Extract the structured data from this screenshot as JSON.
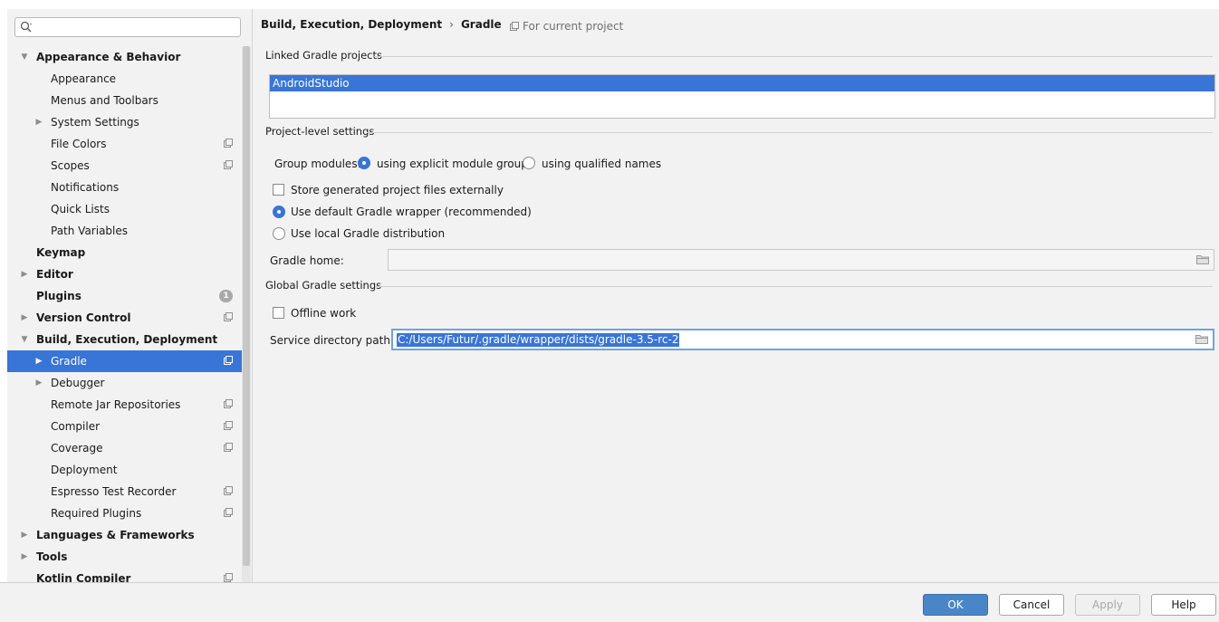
{
  "search": {
    "placeholder": ""
  },
  "sidebar": {
    "items": [
      {
        "label": "Appearance & Behavior",
        "bold": true,
        "level": 0,
        "arrow": "expanded",
        "proj": false
      },
      {
        "label": "Appearance",
        "bold": false,
        "level": 1,
        "arrow": "",
        "proj": false
      },
      {
        "label": "Menus and Toolbars",
        "bold": false,
        "level": 1,
        "arrow": "",
        "proj": false
      },
      {
        "label": "System Settings",
        "bold": false,
        "level": 1,
        "arrow": "collapsed",
        "proj": false
      },
      {
        "label": "File Colors",
        "bold": false,
        "level": 1,
        "arrow": "",
        "proj": true
      },
      {
        "label": "Scopes",
        "bold": false,
        "level": 1,
        "arrow": "",
        "proj": true
      },
      {
        "label": "Notifications",
        "bold": false,
        "level": 1,
        "arrow": "",
        "proj": false
      },
      {
        "label": "Quick Lists",
        "bold": false,
        "level": 1,
        "arrow": "",
        "proj": false
      },
      {
        "label": "Path Variables",
        "bold": false,
        "level": 1,
        "arrow": "",
        "proj": false
      },
      {
        "label": "Keymap",
        "bold": true,
        "level": 0,
        "arrow": "",
        "proj": false
      },
      {
        "label": "Editor",
        "bold": true,
        "level": 0,
        "arrow": "collapsed",
        "proj": false
      },
      {
        "label": "Plugins",
        "bold": true,
        "level": 0,
        "arrow": "",
        "proj": false,
        "badge": "1"
      },
      {
        "label": "Version Control",
        "bold": true,
        "level": 0,
        "arrow": "collapsed",
        "proj": true
      },
      {
        "label": "Build, Execution, Deployment",
        "bold": true,
        "level": 0,
        "arrow": "expanded",
        "proj": false
      },
      {
        "label": "Gradle",
        "bold": false,
        "level": 1,
        "arrow": "collapsed",
        "proj": true,
        "selected": true
      },
      {
        "label": "Debugger",
        "bold": false,
        "level": 1,
        "arrow": "collapsed",
        "proj": false
      },
      {
        "label": "Remote Jar Repositories",
        "bold": false,
        "level": 1,
        "arrow": "",
        "proj": true
      },
      {
        "label": "Compiler",
        "bold": false,
        "level": 1,
        "arrow": "",
        "proj": true
      },
      {
        "label": "Coverage",
        "bold": false,
        "level": 1,
        "arrow": "",
        "proj": true
      },
      {
        "label": "Deployment",
        "bold": false,
        "level": 1,
        "arrow": "",
        "proj": false
      },
      {
        "label": "Espresso Test Recorder",
        "bold": false,
        "level": 1,
        "arrow": "",
        "proj": true
      },
      {
        "label": "Required Plugins",
        "bold": false,
        "level": 1,
        "arrow": "",
        "proj": true
      },
      {
        "label": "Languages & Frameworks",
        "bold": true,
        "level": 0,
        "arrow": "collapsed",
        "proj": false
      },
      {
        "label": "Tools",
        "bold": true,
        "level": 0,
        "arrow": "collapsed",
        "proj": false
      },
      {
        "label": "Kotlin Compiler",
        "bold": true,
        "level": 0,
        "arrow": "",
        "proj": true
      }
    ]
  },
  "breadcrumb": {
    "parent": "Build, Execution, Deployment",
    "separator": "›",
    "current": "Gradle"
  },
  "scope_note": "For current project",
  "linked": {
    "title": "Linked Gradle projects",
    "projects": [
      "AndroidStudio"
    ]
  },
  "project_settings": {
    "title": "Project-level settings",
    "group_modules_label": "Group modules:",
    "option_explicit": "using explicit module groups",
    "option_qualified": "using qualified names",
    "group_modules_value": "explicit",
    "store_external_label": "Store generated project files externally",
    "store_external_checked": false,
    "use_wrapper_label": "Use default Gradle wrapper (recommended)",
    "use_local_label": "Use local Gradle distribution",
    "distribution_value": "wrapper",
    "gradle_home_label": "Gradle home:",
    "gradle_home_value": ""
  },
  "global_settings": {
    "title": "Global Gradle settings",
    "offline_label": "Offline work",
    "offline_checked": false,
    "service_dir_label": "Service directory path:",
    "service_dir_value": "C:/Users/Futur/.gradle/wrapper/dists/gradle-3.5-rc-2"
  },
  "footer": {
    "ok": "OK",
    "cancel": "Cancel",
    "apply": "Apply",
    "help": "Help"
  },
  "colors": {
    "selection": "#3875d7",
    "primary_button": "#4a86c7"
  }
}
